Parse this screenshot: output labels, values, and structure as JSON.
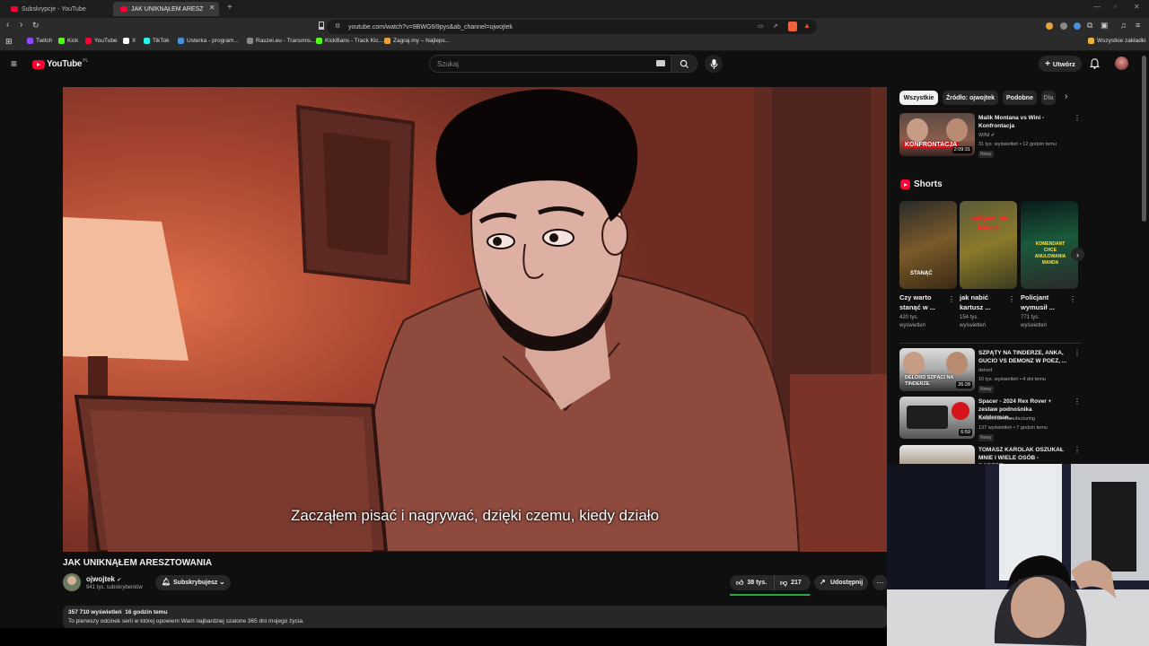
{
  "browser": {
    "tabs": [
      {
        "label": "Subskrypcje - YouTube"
      },
      {
        "label": "JAK UNIKNĄŁEM ARESZTOWANIA"
      }
    ],
    "url": "youtube.com/watch?v=9BWG6i9pys&ab_channel=ojwojtek",
    "bookmarks": [
      {
        "label": "Twitch",
        "color": "#9146ff"
      },
      {
        "label": "Kick",
        "color": "#53fc18"
      },
      {
        "label": "YouTube",
        "color": "#ff0033"
      },
      {
        "label": "X",
        "color": "#ffffff"
      },
      {
        "label": "TikTok",
        "color": "#25f4ee"
      },
      {
        "label": "Usterka - program...",
        "color": "#4a90d9"
      },
      {
        "label": "Raszei.eu - Transmis...",
        "color": "#888888"
      },
      {
        "label": "KickBans - Track Kic...",
        "color": "#53fc18"
      },
      {
        "label": "Zagraj.my – Najleps...",
        "color": "#e8a33d"
      }
    ],
    "all_bookmarks": "Wszystkie zakładki"
  },
  "youtube": {
    "logo": "YouTube",
    "region": "PL",
    "search_placeholder": "Szukaj",
    "create_label": "Utwórz"
  },
  "player": {
    "subtitle": "Zacząłem pisać i nagrywać, dzięki czemu, kiedy działo"
  },
  "video": {
    "title": "JAK UNIKNĄŁEM ARESZTOWANIA",
    "channel": "ojwojtek",
    "subscribers": "941 tys. subskrybentów",
    "subscribe_label": "Subskrybujesz",
    "likes": "38 tys.",
    "dislikes": "217",
    "share_label": "Udostępnij",
    "views_time": "357 710 wyświetleń  16 godzin temu",
    "description": "To pierwszy odcinek serii w której opowiem Wam najbardziej szalone 365 dni mojego życia."
  },
  "sidebar": {
    "chips": [
      "Wszystkie",
      "Źródło: ojwojtek",
      "Podobne",
      "Dla"
    ],
    "top_video": {
      "title": "Malik Montana vs Wini - Konfrontacja",
      "channel": "WINI",
      "meta": "31 tys. wyświetleń • 12 godzin temu",
      "badge": "Nowy",
      "duration": "2:09:31",
      "thumb_text": "KONFRONTACJA"
    },
    "shorts_heading": "Shorts",
    "shorts": [
      {
        "title": "Czy warto stanąć w ...",
        "views": "420 tys. wyświetleń",
        "thumb_text": "STANĄĆ"
      },
      {
        "title": "jak nabić kartusz ...",
        "views": "154 tys. wyświetleń",
        "thumb_text": "Nabijam! Nie kupuję!"
      },
      {
        "title": "Policjant wymusił ...",
        "views": "771 tys. wyświetleń",
        "thumb_text": "KOMENDANT CHCE ANULOWANIA MANDA"
      }
    ],
    "videos": [
      {
        "title": "SZPĄTY NA TINDERZE, ANKA, GUCIO VS DEMONZ W POEZ, ...",
        "channel": "delord",
        "meta": "10 tys. wyświetleń • 4 dni temu",
        "badge": "Nowy",
        "duration": "26:28",
        "thumb_text": "DELORD SZPĄCI NA TINDERZE"
      },
      {
        "title": "Spacer - 2024 Rex Rover + zestaw podnośnika Kelderman...",
        "channel": "Kelderman Manufacturing",
        "meta": "137 wyświetleń • 7 godzin temu",
        "badge": "Nowy",
        "duration": "6:59",
        "thumb_text": ""
      },
      {
        "title": "TOMASZ KAROLAK OSZUKAŁ MNIE I WIELE OSÓB - ROBERT...",
        "channel": "",
        "meta": "",
        "badge": "",
        "duration": "",
        "thumb_text": ""
      }
    ]
  },
  "colors": {
    "accent": "#ff0033",
    "background": "#0f0f0f",
    "chip": "#272727",
    "like_bar": "#2ba640"
  }
}
